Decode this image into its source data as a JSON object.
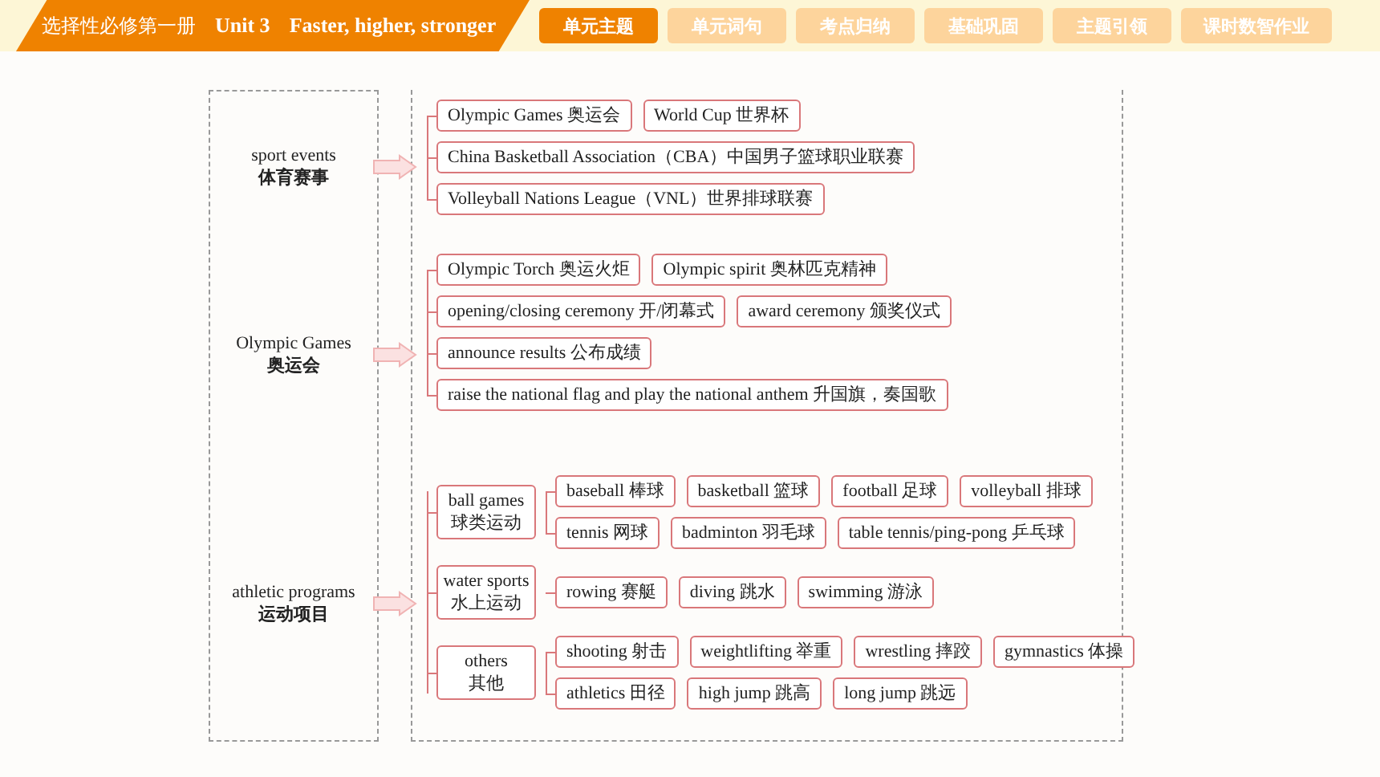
{
  "header": {
    "book": "选择性必修第一册",
    "unit": "Unit 3",
    "title": "Faster, higher, stronger"
  },
  "tabs": [
    {
      "label": "单元主题",
      "selected": true
    },
    {
      "label": "单元词句",
      "selected": false
    },
    {
      "label": "考点归纳",
      "selected": false
    },
    {
      "label": "基础巩固",
      "selected": false
    },
    {
      "label": "主题引领",
      "selected": false
    },
    {
      "label": "课时数智作业",
      "selected": false
    }
  ],
  "sections": [
    {
      "kind": "list",
      "label_en": "sport events",
      "label_zh": "体育赛事",
      "rows": [
        [
          "Olympic Games 奥运会",
          "World Cup 世界杯"
        ],
        [
          "China Basketball Association（CBA）中国男子篮球职业联赛"
        ],
        [
          "Volleyball Nations League（VNL）世界排球联赛"
        ]
      ]
    },
    {
      "kind": "list",
      "label_en": "Olympic Games",
      "label_zh": "奥运会",
      "rows": [
        [
          "Olympic Torch 奥运火炬",
          "Olympic spirit 奥林匹克精神"
        ],
        [
          "opening/closing ceremony 开/闭幕式",
          "award ceremony 颁奖仪式"
        ],
        [
          "announce results 公布成绩"
        ],
        [
          "raise the national flag and play the national anthem 升国旗，奏国歌"
        ]
      ]
    },
    {
      "kind": "groups",
      "label_en": "athletic programs",
      "label_zh": "运动项目",
      "groups": [
        {
          "label_en": "ball games",
          "label_zh": "球类运动",
          "rows": [
            [
              "baseball 棒球",
              "basketball 篮球",
              "football 足球",
              "volleyball 排球"
            ],
            [
              "tennis 网球",
              "badminton 羽毛球",
              "table tennis/ping-pong 乒乓球"
            ]
          ]
        },
        {
          "label_en": "water sports",
          "label_zh": "水上运动",
          "rows": [
            [
              "rowing 赛艇",
              "diving 跳水",
              "swimming 游泳"
            ]
          ]
        },
        {
          "label_en": "others",
          "label_zh": "其他",
          "rows": [
            [
              "shooting 射击",
              "weightlifting 举重",
              "wrestling 摔跤",
              "gymnastics 体操"
            ],
            [
              "athletics 田径",
              "high jump 跳高",
              "long jump 跳远"
            ]
          ]
        }
      ]
    }
  ]
}
